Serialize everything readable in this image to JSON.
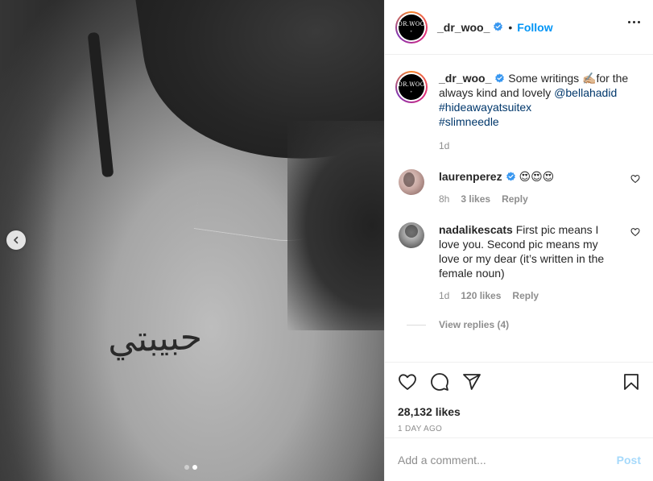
{
  "post": {
    "username": "_dr_woo_",
    "follow_label": "Follow",
    "separator": "•",
    "avatar_text_top": "DR.WOO",
    "avatar_text_bottom": "+",
    "tattoo_text": "حبيبتي",
    "carousel": {
      "total": 2,
      "active_index": 1
    }
  },
  "caption": {
    "username": "_dr_woo_",
    "text_before": " Some writings ✍🏼for the always kind and lovely ",
    "mention": "@bellahadid",
    "hashtag1": "#hideawayatsuitex",
    "hashtag2": "#slimneedle",
    "time": "1d"
  },
  "comments": [
    {
      "username": "laurenperez",
      "text": " 😍😍😍",
      "time": "8h",
      "likes": "3 likes",
      "reply": "Reply"
    },
    {
      "username": "nadalikescats",
      "text": " First pic means I love you. Second pic means my love or my dear (it’s written in the female noun)",
      "time": "1d",
      "likes": "120 likes",
      "reply": "Reply",
      "view_replies": "View replies (4)"
    }
  ],
  "stats": {
    "likes": "28,132 likes",
    "posted": "1 DAY AGO"
  },
  "composer": {
    "placeholder": "Add a comment...",
    "post_label": "Post"
  },
  "colors": {
    "accent": "#0095f6",
    "link": "#00376b",
    "muted": "#8e8e8e"
  },
  "icons": [
    "chevron-left-icon",
    "verified-badge-icon",
    "more-icon",
    "heart-icon",
    "comment-icon",
    "share-icon",
    "bookmark-icon"
  ]
}
